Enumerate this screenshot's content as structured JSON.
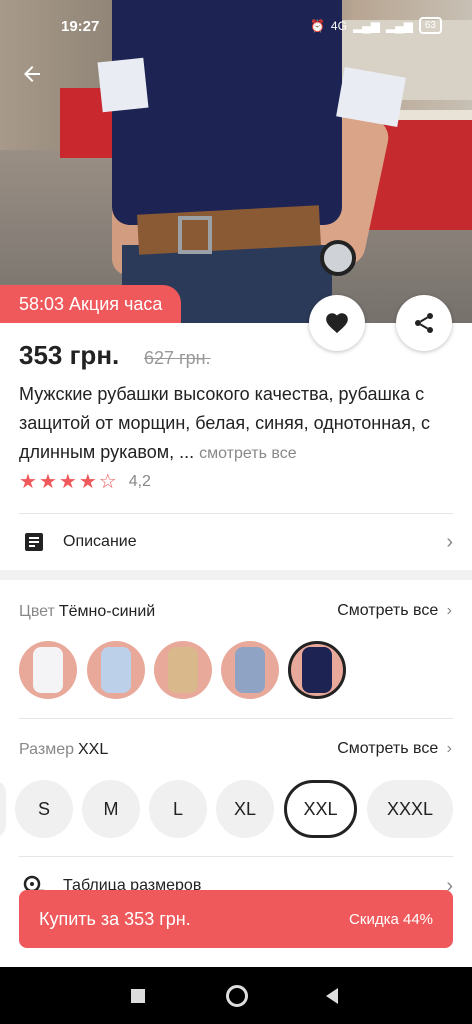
{
  "status_bar": {
    "time": "19:27",
    "network": "4G",
    "battery": "63"
  },
  "promo": {
    "text": "58:03 Акция часа"
  },
  "product": {
    "price": "353 грн.",
    "old_price": "627 грн.",
    "title": "Мужские рубашки высокого качества, рубашка с защитой от морщин, белая, синяя, однотонная, с длинным рукавом, ...",
    "see_all_text": "смотреть все",
    "rating_value": "4,2",
    "rating_stars": 4
  },
  "description": {
    "label": "Описание"
  },
  "color": {
    "label": "Цвет",
    "selected": "Тёмно-синий",
    "see_all": "Смотреть все",
    "swatches": [
      "white",
      "light-blue",
      "beige",
      "grey-blue",
      "navy"
    ]
  },
  "size": {
    "label": "Размер",
    "selected": "XXL",
    "see_all": "Смотреть все",
    "options": [
      "S",
      "M",
      "L",
      "XL",
      "XXL",
      "XXXL"
    ]
  },
  "size_table": {
    "label": "Таблица размеров"
  },
  "buy_button": {
    "label": "Купить за 353 грн.",
    "discount": "Скидка 44%"
  },
  "colors": {
    "accent": "#f0595b",
    "navy": "#1d2453"
  }
}
